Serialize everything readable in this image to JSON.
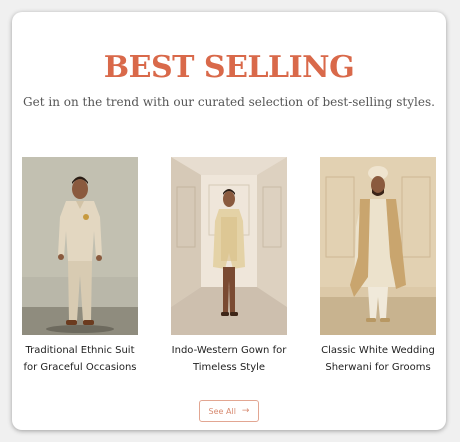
{
  "section": {
    "title": "BEST SELLING",
    "subtitle": "Get in on the trend with our curated selection of best-selling styles."
  },
  "products": [
    {
      "name_line1": "Traditional Ethnic Suit",
      "name_line2": "for Graceful Occasions"
    },
    {
      "name_line1": "Indo-Western Gown for",
      "name_line2": "Timeless Style"
    },
    {
      "name_line1": "Classic White Wedding",
      "name_line2": "Sherwani for Grooms"
    }
  ],
  "cta": {
    "label": "See All",
    "icon": "arrow-right-icon"
  },
  "colors": {
    "accent": "#d9694a",
    "button_border": "#e2a692",
    "text": "#222222",
    "subtitle": "#555555"
  }
}
